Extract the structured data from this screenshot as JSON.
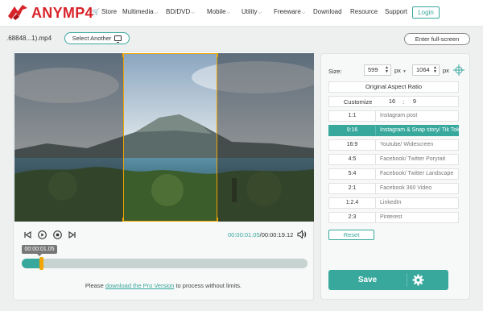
{
  "nav": {
    "brand": "ANYMP4",
    "items": [
      {
        "label": "Store",
        "has_dropdown": false,
        "icon": "cart-icon"
      },
      {
        "label": "Multimedia",
        "has_dropdown": true
      },
      {
        "label": "BD/DVD",
        "has_dropdown": true
      },
      {
        "label": "Mobile",
        "has_dropdown": true
      },
      {
        "label": "Utility",
        "has_dropdown": true
      },
      {
        "label": "Freeware",
        "has_dropdown": true
      },
      {
        "label": "Download",
        "has_dropdown": false
      },
      {
        "label": "Resource",
        "has_dropdown": false
      },
      {
        "label": "Support",
        "has_dropdown": false
      }
    ],
    "login": "Login"
  },
  "toolbar": {
    "file_name": ".68848...1).mp4",
    "select_another": "Select Another",
    "fullscreen": "Enter full-screen"
  },
  "player": {
    "current_time": "00:00:01.05",
    "total_time": "/00:00:19.12",
    "tooltip_time": "00:00:01.05",
    "progress_fraction": 0.069
  },
  "note": {
    "prefix": "Please ",
    "link": "download the Pro Version",
    "suffix": " to process without limits."
  },
  "crop": {
    "size_label": "Size:",
    "width": "599",
    "height": "1064",
    "unit": "px",
    "original_ratio": "Original Aspect Ratio",
    "custom_label": "Customize",
    "custom_w": "16",
    "custom_sep": ":",
    "custom_h": "9",
    "ratios": [
      {
        "ratio": "1:1",
        "name": "Instagram post",
        "active": false
      },
      {
        "ratio": "9:16",
        "name": "Instagram & Snap story/ Tik Tok",
        "active": true
      },
      {
        "ratio": "16:9",
        "name": "Youtube/ Widescreen",
        "active": false
      },
      {
        "ratio": "4:5",
        "name": "Facebook/ Twitter Poryrait",
        "active": false
      },
      {
        "ratio": "5:4",
        "name": "Facebook/ Twitter Landscape",
        "active": false
      },
      {
        "ratio": "2:1",
        "name": "Facebook 360 Video",
        "active": false
      },
      {
        "ratio": "1:2.4",
        "name": "LinkedIn",
        "active": false
      },
      {
        "ratio": "2:3",
        "name": "Pinterest",
        "active": false
      }
    ],
    "reset": "Reset",
    "save": "Save"
  },
  "colors": {
    "accent": "#38a89d",
    "brand": "#d8232a",
    "crop_frame": "#f0a500"
  }
}
